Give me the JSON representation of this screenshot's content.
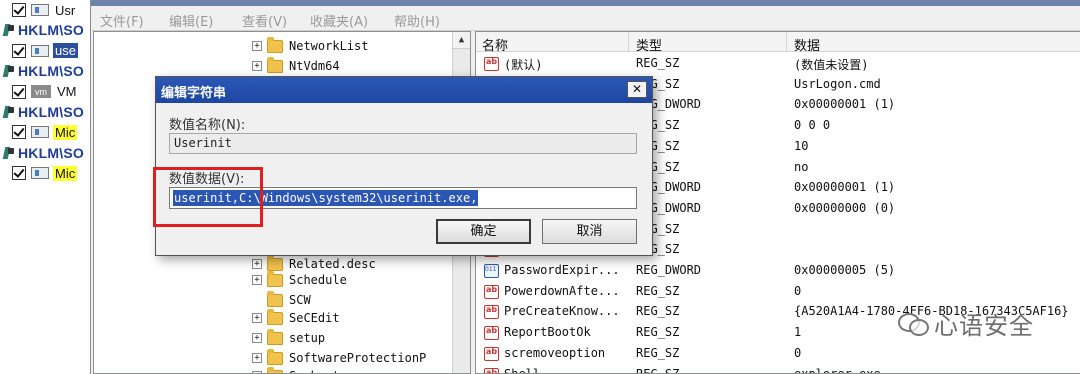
{
  "left_strip": {
    "rows": [
      {
        "kind": "entry",
        "icon": "app-icon",
        "tag": "Usr",
        "tag_style": "plain"
      },
      {
        "kind": "key",
        "label": "HKLM\\SO"
      },
      {
        "kind": "entry",
        "icon": "app-icon",
        "tag": "use",
        "tag_style": "selected"
      },
      {
        "kind": "key",
        "label": "HKLM\\SO"
      },
      {
        "kind": "entry",
        "icon": "vm-icon",
        "icon_text": "vm",
        "tag": "VM",
        "tag_style": "plain"
      },
      {
        "kind": "key",
        "label": "HKLM\\SO"
      },
      {
        "kind": "entry",
        "icon": "app-icon",
        "tag": "Mic",
        "tag_style": "highlight"
      },
      {
        "kind": "key",
        "label": "HKLM\\SO"
      },
      {
        "kind": "entry",
        "icon": "app-icon",
        "tag": "Mic",
        "tag_style": "highlight"
      }
    ]
  },
  "regedit": {
    "menu": [
      "文件(F)",
      "编辑(E)",
      "查看(V)",
      "收藏夹(A)",
      "帮助(H)"
    ],
    "tree": [
      {
        "label": "NetworkList",
        "expander": "+"
      },
      {
        "label": "NtVdm64",
        "expander": "+"
      },
      {
        "label": "Related.desc",
        "expander": "+"
      },
      {
        "label": "Schedule",
        "expander": "+"
      },
      {
        "label": "SCW",
        "expander": ""
      },
      {
        "label": "SeCEdit",
        "expander": "+"
      },
      {
        "label": "setup",
        "expander": "+"
      },
      {
        "label": "SoftwareProtectionP",
        "expander": "+"
      },
      {
        "label": "Svchost",
        "expander": "+"
      }
    ],
    "tree_scroll_up": "▲",
    "list_headers": {
      "name": "名称",
      "type": "类型",
      "data": "数据"
    },
    "rows": [
      {
        "icon": "sz",
        "name": "(默认)",
        "type": "REG_SZ",
        "data": "(数值未设置)"
      },
      {
        "icon": "sz",
        "name": "",
        "type": "REG_SZ",
        "data": "UsrLogon.cmd"
      },
      {
        "icon": "dw",
        "name": "",
        "type": "REG_DWORD",
        "data": "0x00000001 (1)"
      },
      {
        "icon": "sz",
        "name": "",
        "type": "REG_SZ",
        "data": "0 0 0"
      },
      {
        "icon": "sz",
        "name": "",
        "type": "REG_SZ",
        "data": "10"
      },
      {
        "icon": "sz",
        "name": "",
        "type": "REG_SZ",
        "data": "no"
      },
      {
        "icon": "dw",
        "name": "",
        "type": "REG_DWORD",
        "data": "0x00000001 (1)"
      },
      {
        "icon": "dw",
        "name": "",
        "type": "REG_DWORD",
        "data": "0x00000000 (0)"
      },
      {
        "icon": "sz",
        "name": "",
        "type": "REG_SZ",
        "data": ""
      },
      {
        "icon": "sz",
        "name": "",
        "type": "REG_SZ",
        "data": ""
      },
      {
        "icon": "dw",
        "name": "PasswordExpir...",
        "type": "REG_DWORD",
        "data": "0x00000005 (5)"
      },
      {
        "icon": "sz",
        "name": "PowerdownAfte...",
        "type": "REG_SZ",
        "data": "0"
      },
      {
        "icon": "sz",
        "name": "PreCreateKnow...",
        "type": "REG_SZ",
        "data": "{A520A1A4-1780-4FF6-BD18-167343C5AF16}"
      },
      {
        "icon": "sz",
        "name": "ReportBootOk",
        "type": "REG_SZ",
        "data": "1"
      },
      {
        "icon": "sz",
        "name": "scremoveoption",
        "type": "REG_SZ",
        "data": "0"
      },
      {
        "icon": "sz",
        "name": "Shell",
        "type": "REG_SZ",
        "data": "explorer.exe"
      }
    ]
  },
  "dialog": {
    "title": "编辑字符串",
    "close_glyph": "✕",
    "name_label": "数值名称(N):",
    "name_value": "Userinit",
    "data_label": "数值数据(V):",
    "data_value": "userinit,C:\\Windows\\system32\\userinit.exe,",
    "ok_label": "确定",
    "cancel_label": "取消"
  },
  "watermark": {
    "text": "心语安全"
  },
  "colors": {
    "highlight_box": "#e02020",
    "selection": "#2c56b3",
    "dialog_title": "#1d46a1",
    "tag_highlight": "#ffff33"
  }
}
